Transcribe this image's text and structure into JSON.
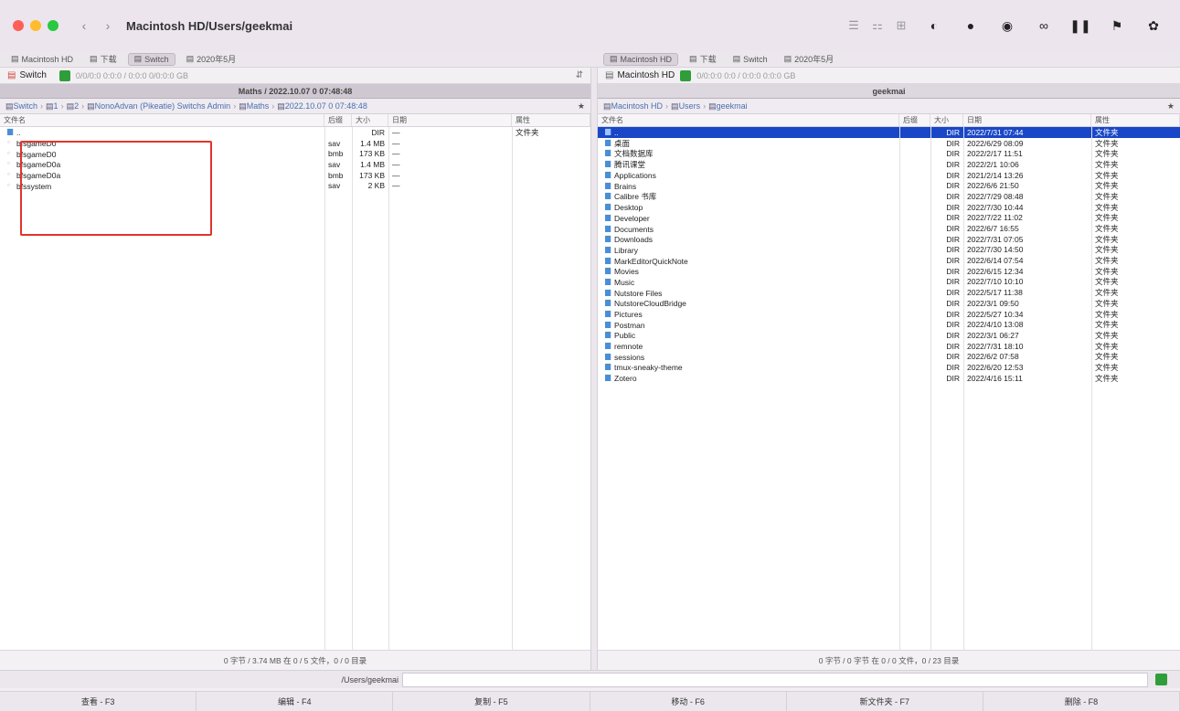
{
  "window": {
    "title": "Macintosh HD/Users/geekmai",
    "traffic": [
      "#ff5f57",
      "#febc2e",
      "#28c840"
    ],
    "nav_back": "‹",
    "nav_forward": "›"
  },
  "toolbar": {
    "view_icons": [
      "list-view-icon",
      "column-view-icon",
      "grid-view-icon"
    ],
    "view_glyphs": [
      "☰",
      "⚏",
      "⊞"
    ],
    "icons": [
      "toggle-icon",
      "sync-icon",
      "eye-icon",
      "binoculars-icon",
      "pause-icon",
      "flag-icon",
      "gear-icon"
    ],
    "glyphs": [
      "◐",
      "●",
      "◉",
      "∞",
      "❚❚",
      "⚑",
      "✿"
    ]
  },
  "left_pane": {
    "tabs": [
      {
        "label": "Macintosh HD",
        "active": false
      },
      {
        "label": "下载",
        "active": false
      },
      {
        "label": "Switch",
        "active": true
      },
      {
        "label": "2020年5月",
        "active": false
      }
    ],
    "location": "Switch",
    "location_info": "0/0/0:0 0:0:0 / 0:0:0 0/0:0:0 GB",
    "header_title": "Maths / 2022.10.07 0 07:48:48",
    "breadcrumb": [
      "Switch",
      "1",
      "2",
      "NonoAdvan (Pikeatie) Switchs Admin",
      "Maths",
      "2022.10.07 0 07:48:48"
    ],
    "columns": [
      "文件名",
      "后缀",
      "大小",
      "日期",
      "属性"
    ],
    "rows": [
      {
        "name": "..",
        "ext": "",
        "size": "DIR",
        "date": "—",
        "attr": "文件夹",
        "dir": true
      },
      {
        "name": "bfsgameD0",
        "ext": "sav",
        "size": "1.4 MB",
        "date": "—",
        "attr": "",
        "dir": false
      },
      {
        "name": "bfsgameD0",
        "ext": "bmb",
        "size": "173 KB",
        "date": "—",
        "attr": "",
        "dir": false
      },
      {
        "name": "bfsgameD0a",
        "ext": "sav",
        "size": "1.4 MB",
        "date": "—",
        "attr": "",
        "dir": false
      },
      {
        "name": "bfsgameD0a",
        "ext": "bmb",
        "size": "173 KB",
        "date": "—",
        "attr": "",
        "dir": false
      },
      {
        "name": "bfssystem",
        "ext": "sav",
        "size": "2 KB",
        "date": "—",
        "attr": "",
        "dir": false
      }
    ],
    "status": "0 字节 / 3.74 MB 在 0 / 5 文件，0 / 0 目录"
  },
  "right_pane": {
    "tabs": [
      {
        "label": "Macintosh HD",
        "active": true
      },
      {
        "label": "下载",
        "active": false
      },
      {
        "label": "Switch",
        "active": false
      },
      {
        "label": "2020年5月",
        "active": false
      }
    ],
    "location": "Macintosh HD",
    "location_info": "0/0:0:0 0:0 / 0:0:0 0:0:0 GB",
    "header_title": "geekmai",
    "breadcrumb": [
      "Macintosh HD",
      "Users",
      "geekmai"
    ],
    "columns": [
      "文件名",
      "后缀",
      "大小",
      "日期",
      "属性"
    ],
    "rows": [
      {
        "name": "..",
        "ext": "",
        "size": "DIR",
        "date": "2022/7/31 07:44",
        "attr": "文件夹",
        "dir": true,
        "selected": true
      },
      {
        "name": "桌面",
        "ext": "",
        "size": "DIR",
        "date": "2022/6/29 08:09",
        "attr": "文件夹",
        "dir": true
      },
      {
        "name": "文档数据库",
        "ext": "",
        "size": "DIR",
        "date": "2022/2/17 11:51",
        "attr": "文件夹",
        "dir": true
      },
      {
        "name": "腾讯课堂",
        "ext": "",
        "size": "DIR",
        "date": "2022/2/1 10:06",
        "attr": "文件夹",
        "dir": true
      },
      {
        "name": "Applications",
        "ext": "",
        "size": "DIR",
        "date": "2021/2/14 13:26",
        "attr": "文件夹",
        "dir": true
      },
      {
        "name": "Brains",
        "ext": "",
        "size": "DIR",
        "date": "2022/6/6 21:50",
        "attr": "文件夹",
        "dir": true
      },
      {
        "name": "Calibre 书库",
        "ext": "",
        "size": "DIR",
        "date": "2022/7/29 08:48",
        "attr": "文件夹",
        "dir": true
      },
      {
        "name": "Desktop",
        "ext": "",
        "size": "DIR",
        "date": "2022/7/30 10:44",
        "attr": "文件夹",
        "dir": true
      },
      {
        "name": "Developer",
        "ext": "",
        "size": "DIR",
        "date": "2022/7/22 11:02",
        "attr": "文件夹",
        "dir": true
      },
      {
        "name": "Documents",
        "ext": "",
        "size": "DIR",
        "date": "2022/6/7 16:55",
        "attr": "文件夹",
        "dir": true
      },
      {
        "name": "Downloads",
        "ext": "",
        "size": "DIR",
        "date": "2022/7/31 07:05",
        "attr": "文件夹",
        "dir": true
      },
      {
        "name": "Library",
        "ext": "",
        "size": "DIR",
        "date": "2022/7/30 14:50",
        "attr": "文件夹",
        "dir": true
      },
      {
        "name": "MarkEditorQuickNote",
        "ext": "",
        "size": "DIR",
        "date": "2022/6/14 07:54",
        "attr": "文件夹",
        "dir": true
      },
      {
        "name": "Movies",
        "ext": "",
        "size": "DIR",
        "date": "2022/6/15 12:34",
        "attr": "文件夹",
        "dir": true
      },
      {
        "name": "Music",
        "ext": "",
        "size": "DIR",
        "date": "2022/7/10 10:10",
        "attr": "文件夹",
        "dir": true
      },
      {
        "name": "Nutstore Files",
        "ext": "",
        "size": "DIR",
        "date": "2022/5/17 11:38",
        "attr": "文件夹",
        "dir": true
      },
      {
        "name": "NutstoreCloudBridge",
        "ext": "",
        "size": "DIR",
        "date": "2022/3/1 09:50",
        "attr": "文件夹",
        "dir": true
      },
      {
        "name": "Pictures",
        "ext": "",
        "size": "DIR",
        "date": "2022/5/27 10:34",
        "attr": "文件夹",
        "dir": true
      },
      {
        "name": "Postman",
        "ext": "",
        "size": "DIR",
        "date": "2022/4/10 13:08",
        "attr": "文件夹",
        "dir": true
      },
      {
        "name": "Public",
        "ext": "",
        "size": "DIR",
        "date": "2022/3/1 06:27",
        "attr": "文件夹",
        "dir": true
      },
      {
        "name": "remnote",
        "ext": "",
        "size": "DIR",
        "date": "2022/7/31 18:10",
        "attr": "文件夹",
        "dir": true
      },
      {
        "name": "sessions",
        "ext": "",
        "size": "DIR",
        "date": "2022/6/2 07:58",
        "attr": "文件夹",
        "dir": true
      },
      {
        "name": "tmux-sneaky-theme",
        "ext": "",
        "size": "DIR",
        "date": "2022/6/20 12:53",
        "attr": "文件夹",
        "dir": true
      },
      {
        "name": "Zotero",
        "ext": "",
        "size": "DIR",
        "date": "2022/4/16 15:11",
        "attr": "文件夹",
        "dir": true
      }
    ],
    "status": "0 字节 / 0 字节 在 0 / 0 文件，0 / 23 目录"
  },
  "command": {
    "label": "/Users/geekmai",
    "value": ""
  },
  "fkeys": [
    "查看 - F3",
    "编辑 - F4",
    "复制 - F5",
    "移动 - F6",
    "新文件夹 - F7",
    "删除 - F8"
  ]
}
